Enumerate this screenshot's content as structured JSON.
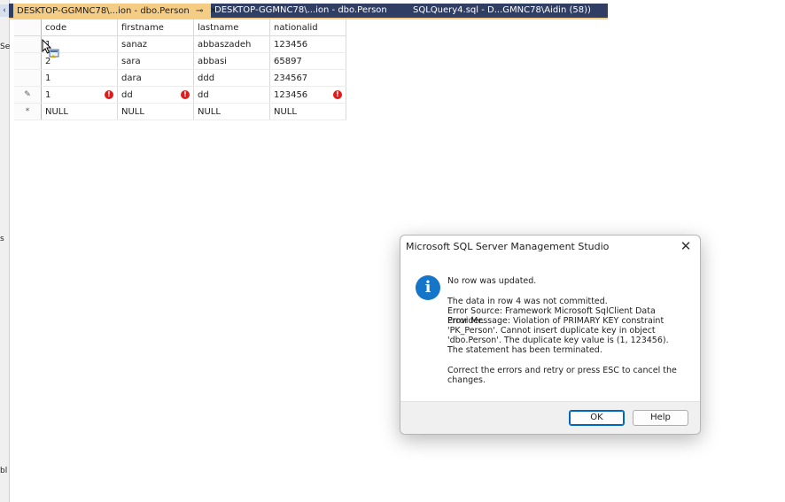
{
  "left_panel": {
    "fragment_top": "Se",
    "fragment_mid": "s",
    "fragment_bottom": "bl"
  },
  "tabs": [
    {
      "label": "DESKTOP-GGMNC78\\...ion - dbo.Person",
      "active": true
    },
    {
      "label": "DESKTOP-GGMNC78\\...ion - dbo.Person",
      "active": false
    },
    {
      "label": "SQLQuery4.sql - D...GMNC78\\Aidin (58))",
      "active": false
    }
  ],
  "grid": {
    "columns": [
      "code",
      "firstname",
      "lastname",
      "nationalid"
    ],
    "rows": [
      {
        "marker": "",
        "code": "1",
        "firstname": "sanaz",
        "lastname": "abbaszadeh",
        "nationalid": "123456"
      },
      {
        "marker": "",
        "code": "2",
        "firstname": "sara",
        "lastname": "abbasi",
        "nationalid": "65897"
      },
      {
        "marker": "",
        "code": "1",
        "firstname": "dara",
        "lastname": "ddd",
        "nationalid": "234567"
      },
      {
        "marker": "✎",
        "code": "1",
        "firstname": "dd",
        "lastname": "dd",
        "nationalid": "123456"
      },
      {
        "marker": "*",
        "code": "NULL",
        "firstname": "NULL",
        "lastname": "NULL",
        "nationalid": "NULL"
      }
    ]
  },
  "dialog": {
    "title": "Microsoft SQL Server Management Studio",
    "heading": "No row was updated.",
    "lines": [
      "The data in row 4 was not committed.",
      "Error Source: Framework Microsoft SqlClient Data Provider.",
      "Error Message: Violation of PRIMARY KEY constraint",
      "'PK_Person'. Cannot insert duplicate key in object",
      "'dbo.Person'. The duplicate key value is (1, 123456).",
      "The statement has been terminated."
    ],
    "footer_lines": [
      "Correct the errors and retry or press ESC to cancel the",
      "changes."
    ],
    "ok_label": "OK",
    "help_label": "Help"
  }
}
